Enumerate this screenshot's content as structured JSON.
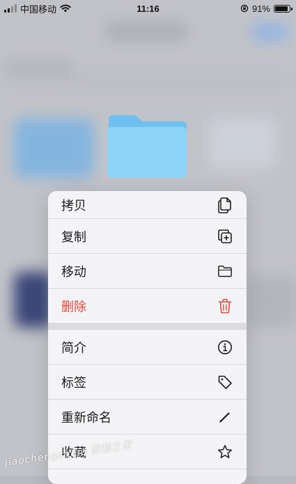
{
  "status_bar": {
    "carrier": "中国移动",
    "time": "11:16",
    "battery": "91%"
  },
  "context_menu": {
    "items": [
      {
        "label": "拷贝",
        "icon": "copy-icon"
      },
      {
        "label": "复制",
        "icon": "duplicate-icon"
      },
      {
        "label": "移动",
        "icon": "folder-icon"
      },
      {
        "label": "删除",
        "icon": "trash-icon",
        "color": "#e0463c"
      },
      {
        "label": "简介",
        "icon": "info-icon"
      },
      {
        "label": "标签",
        "icon": "tag-icon"
      },
      {
        "label": "重新命名",
        "icon": "pencil-icon"
      },
      {
        "label": "收藏",
        "icon": "star-icon"
      }
    ]
  },
  "colors": {
    "destructive": "#e0463c",
    "folder": "#7cc7f2"
  },
  "watermark": "jiaochengzhijia 教程之家"
}
